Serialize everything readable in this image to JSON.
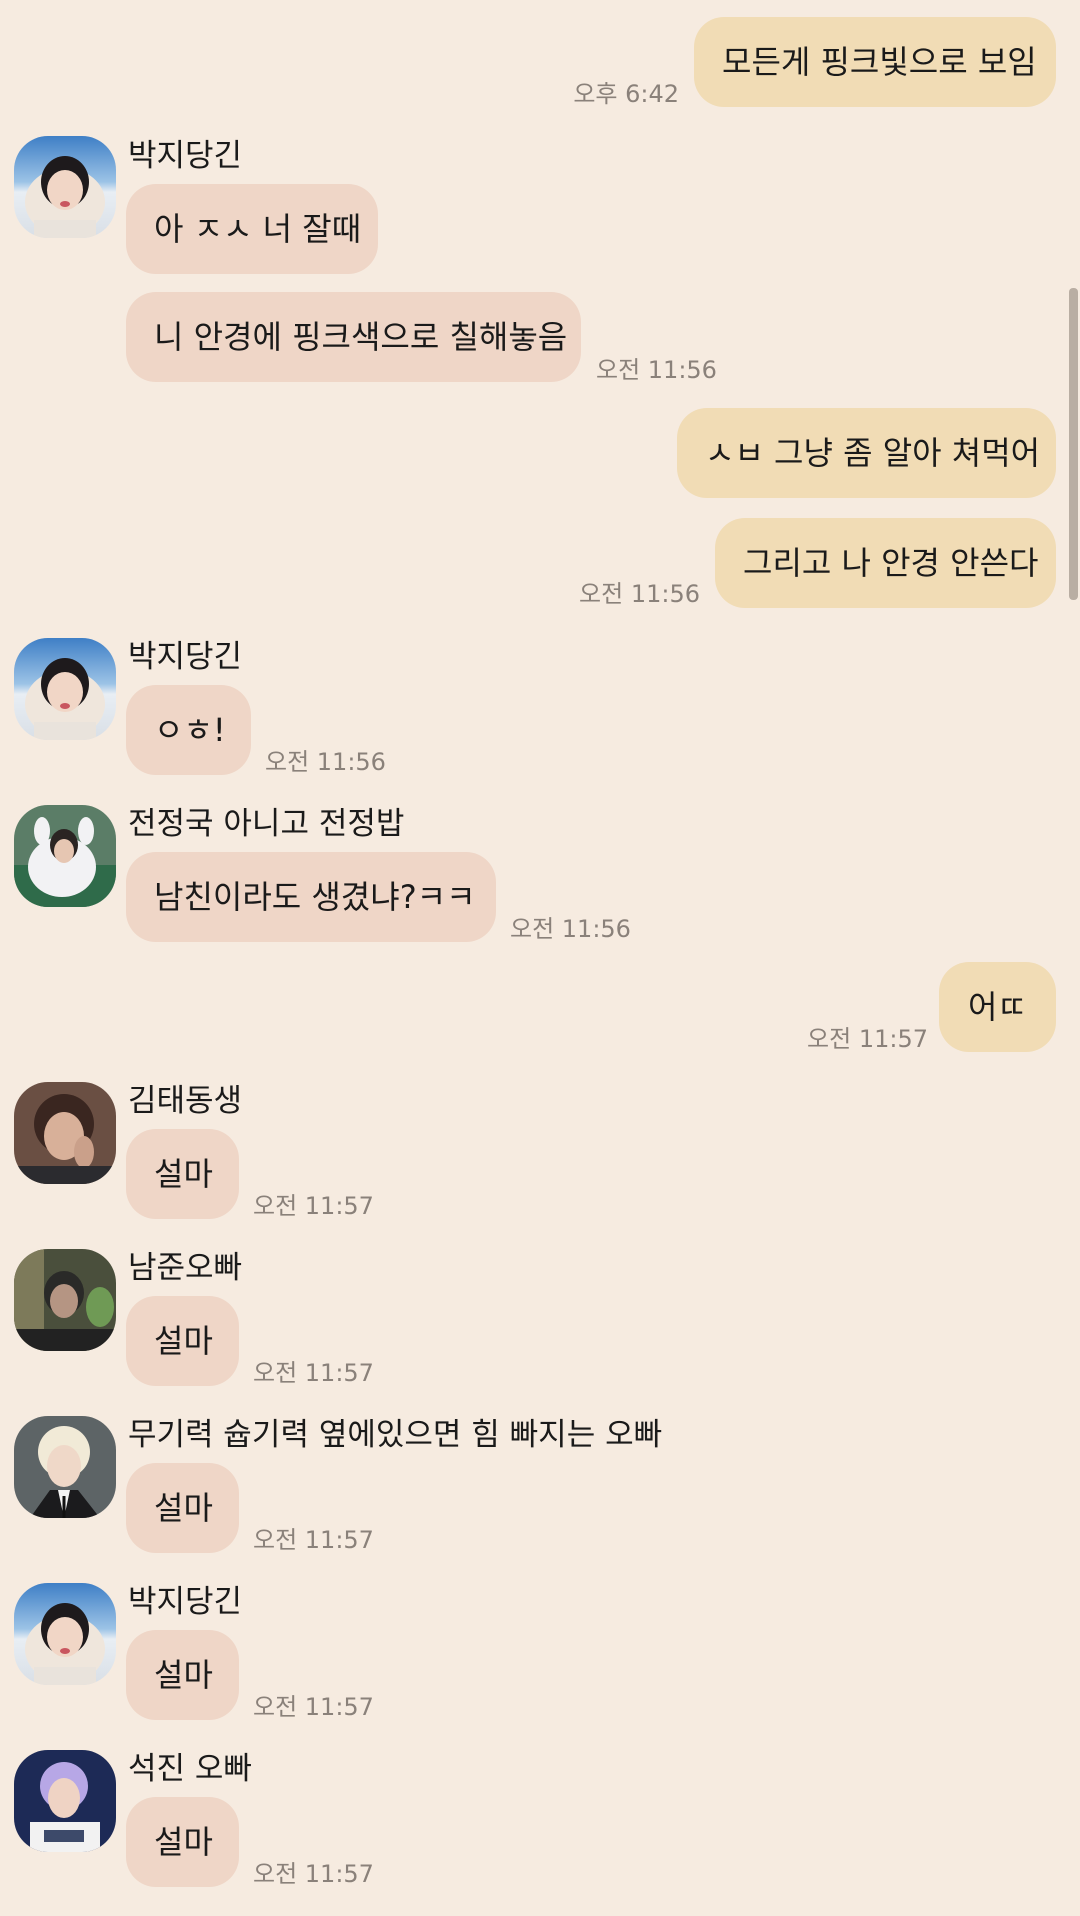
{
  "colors": {
    "background": "#f6ebe0",
    "outgoing_bubble": "#f1dcb5",
    "incoming_bubble": "#efd6c7",
    "timestamp": "#8a817a"
  },
  "messages": [
    {
      "text": "모든게 핑크빛으로 보임",
      "time": "오후 6:42",
      "direction": "outgoing"
    },
    {
      "sender": "박지당긴",
      "avatar": "avatar-jimin-icon",
      "text": "아 ㅈㅅ 너 잘때",
      "direction": "incoming"
    },
    {
      "text": "니 안경에 핑크색으로 칠해놓음",
      "time": "오전 11:56",
      "direction": "incoming"
    },
    {
      "text": "ㅅㅂ 그냥 좀 알아 쳐먹어",
      "direction": "outgoing"
    },
    {
      "text": "그리고 나 안경 안쓴다",
      "time": "오전 11:56",
      "direction": "outgoing"
    },
    {
      "sender": "박지당긴",
      "avatar": "avatar-jimin-icon",
      "text": "ㅇㅎ!",
      "time": "오전 11:56",
      "direction": "incoming"
    },
    {
      "sender": "전정국 아니고 전정밥",
      "avatar": "avatar-jungkook-icon",
      "text": "남친이라도 생겼냐?ㅋㅋ",
      "time": "오전 11:56",
      "direction": "incoming"
    },
    {
      "text": "어ㄸ",
      "time": "오전 11:57",
      "direction": "outgoing"
    },
    {
      "sender": "김태동생",
      "avatar": "avatar-taehyung-icon",
      "text": "설마",
      "time": "오전 11:57",
      "direction": "incoming"
    },
    {
      "sender": "남준오빠",
      "avatar": "avatar-namjoon-icon",
      "text": "설마",
      "time": "오전 11:57",
      "direction": "incoming"
    },
    {
      "sender": "무기력 슙기력 옆에있으면 힘 빠지는 오빠",
      "avatar": "avatar-yoongi-icon",
      "text": "설마",
      "time": "오전 11:57",
      "direction": "incoming"
    },
    {
      "sender": "박지당긴",
      "avatar": "avatar-jimin-icon",
      "text": "설마",
      "time": "오전 11:57",
      "direction": "incoming"
    },
    {
      "sender": "석진 오빠",
      "avatar": "avatar-seokjin-icon",
      "text": "설마",
      "time": "오전 11:57",
      "direction": "incoming"
    }
  ]
}
